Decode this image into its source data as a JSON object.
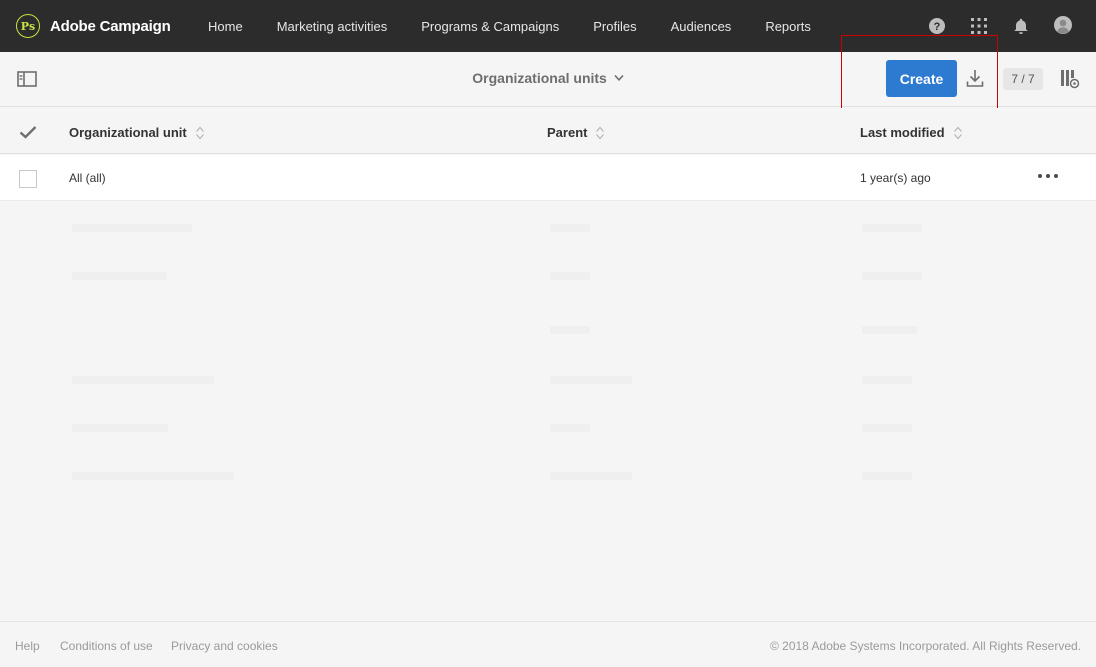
{
  "app": {
    "brand_name": "Adobe Campaign",
    "brand_logo_glyph": "Ps"
  },
  "nav": {
    "items": [
      {
        "label": "Home"
      },
      {
        "label": "Marketing activities"
      },
      {
        "label": "Programs & Campaigns"
      },
      {
        "label": "Profiles"
      },
      {
        "label": "Audiences"
      },
      {
        "label": "Reports"
      }
    ],
    "icons": [
      "help-icon",
      "apps-grid-icon",
      "bell-icon",
      "user-avatar-icon"
    ]
  },
  "toolbar": {
    "view_title": "Organizational units",
    "create_label": "Create",
    "count_label": "7 / 7"
  },
  "table": {
    "columns": [
      {
        "label": "Organizational unit"
      },
      {
        "label": "Parent"
      },
      {
        "label": "Last modified"
      }
    ],
    "rows": [
      {
        "unit": "All (all)",
        "parent": "",
        "last_modified": "1 year(s) ago"
      }
    ]
  },
  "footer": {
    "links": [
      {
        "label": "Help"
      },
      {
        "label": "Conditions of use"
      },
      {
        "label": "Privacy and cookies"
      }
    ],
    "copyright": "© 2018 Adobe Systems Incorporated. All Rights Reserved."
  },
  "colors": {
    "topbar": "#2c2c2c",
    "primary_button": "#2d7ad1",
    "highlight_box": "#cc0000",
    "brand_accent": "#c9e341"
  }
}
